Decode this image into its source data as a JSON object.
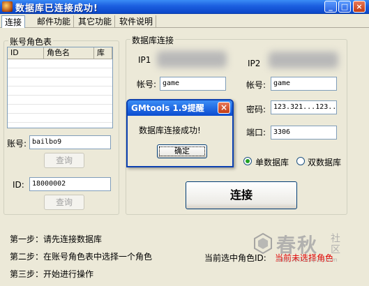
{
  "window": {
    "title": "数据库已连接成功!",
    "min": "_",
    "max": "□",
    "close": "×"
  },
  "menu": [
    "连接",
    "邮件功能",
    "其它功能",
    "软件说明"
  ],
  "left_panel": {
    "title": "账号角色表",
    "columns": [
      "ID",
      "角色名",
      "库"
    ],
    "account_label": "账号:",
    "account_value": "bailbo9",
    "query_label": "查询",
    "id_label": "ID:",
    "id_value": "18000002",
    "query2_label": "查询"
  },
  "db_panel": {
    "title": "数据库连接",
    "ip1_label": "IP1",
    "ip2_label": "IP2",
    "account1_label": "帐号:",
    "account1_value": "game",
    "account2_label": "帐号:",
    "account2_value": "game",
    "password_label": "密码:",
    "password_value": "123.321...123...",
    "port_label": "端口:",
    "port_value": "3306",
    "radio_single": "单数据库",
    "radio_double": "双数据库",
    "connect_label": "连接"
  },
  "dialog": {
    "title": "GMtools 1.9提醒",
    "message": "数据库连接成功!",
    "ok_label": "确定"
  },
  "steps": {
    "step1": "第一步：请先连接数据库",
    "step2": "第二步：在账号角色表中选择一个角色",
    "step3": "第三步：开始进行操作"
  },
  "status": {
    "label": "当前选中角色ID:",
    "value": "当前未选择角色"
  },
  "watermark": {
    "main": "春秋",
    "side": "社区",
    "url": "bbs.ichunqiu.com"
  },
  "colors": {
    "status_value": "#e00000",
    "titlebar": "#0a46c8"
  }
}
